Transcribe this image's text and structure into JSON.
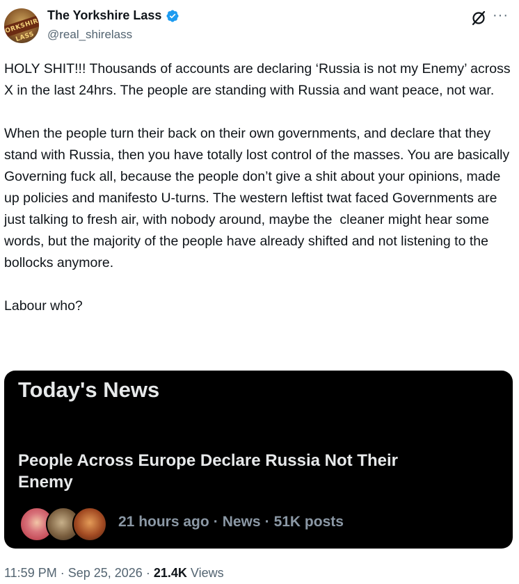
{
  "author": {
    "display_name": "The Yorkshire Lass",
    "handle": "@real_shirelass",
    "avatar_text": "YORKSHIRE LASS",
    "verified_color": "#1d9bf0"
  },
  "tweet": {
    "paragraphs": [
      "HOLY SHIT!!! Thousands of accounts are declaring ‘Russia is not my Enemy’ across X in the last 24hrs. The people are standing with Russia and want peace, not war.",
      "When the people turn their back on their own governments, and declare that they stand with Russia, then you have totally lost control of the masses. You are basically Governing fuck all, because the people don’t give a shit about your opinions, made up policies and manifesto U-turns. The western leftist twat faced Governments are just talking to fresh air, with nobody around, maybe the  cleaner might hear some words, but the majority of the people have already shifted and not listening to the bollocks anymore.",
      "Labour who?"
    ]
  },
  "card": {
    "title": "Today's News",
    "headline": "People Across Europe Declare Russia Not Their Enemy",
    "time_ago": "21 hours ago",
    "category": "News",
    "posts": "51K posts"
  },
  "footer": {
    "time": "11:59 PM",
    "date": "Sep 25, 2026",
    "views_count": "21.4K",
    "views_label": "Views"
  },
  "icons": {
    "grok": "grok-icon",
    "more": "more-icon",
    "verified": "verified-badge-icon"
  }
}
